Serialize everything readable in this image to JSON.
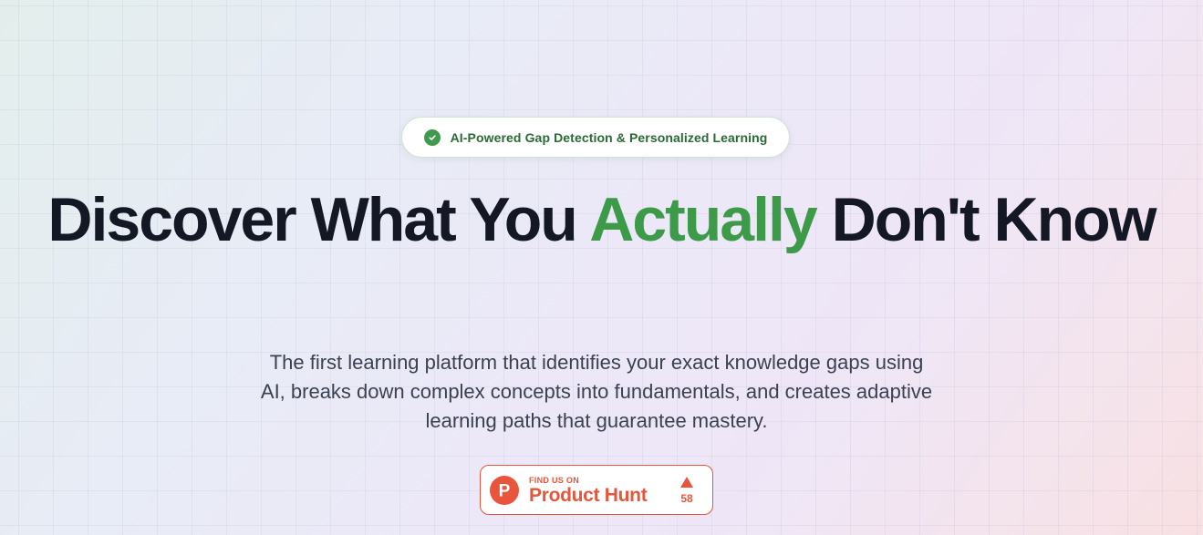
{
  "badge": {
    "text": "AI-Powered Gap Detection & Personalized Learning",
    "icon": "check-circle-icon"
  },
  "hero": {
    "title_part1": "Discover What You ",
    "title_accent": "Actually",
    "title_part2": " Don't Know",
    "subtitle": "The first learning platform that identifies your exact knowledge gaps using AI, breaks down complex concepts into fundamentals, and creates adaptive learning paths that guarantee mastery."
  },
  "product_hunt": {
    "small_label": "FIND US ON",
    "name": "Product Hunt",
    "upvotes": "58",
    "logo_letter": "P",
    "icon": "upvote-triangle-icon"
  },
  "colors": {
    "accent_green": "#3c9a48",
    "product_hunt": "#e8553a",
    "title": "#141824"
  }
}
